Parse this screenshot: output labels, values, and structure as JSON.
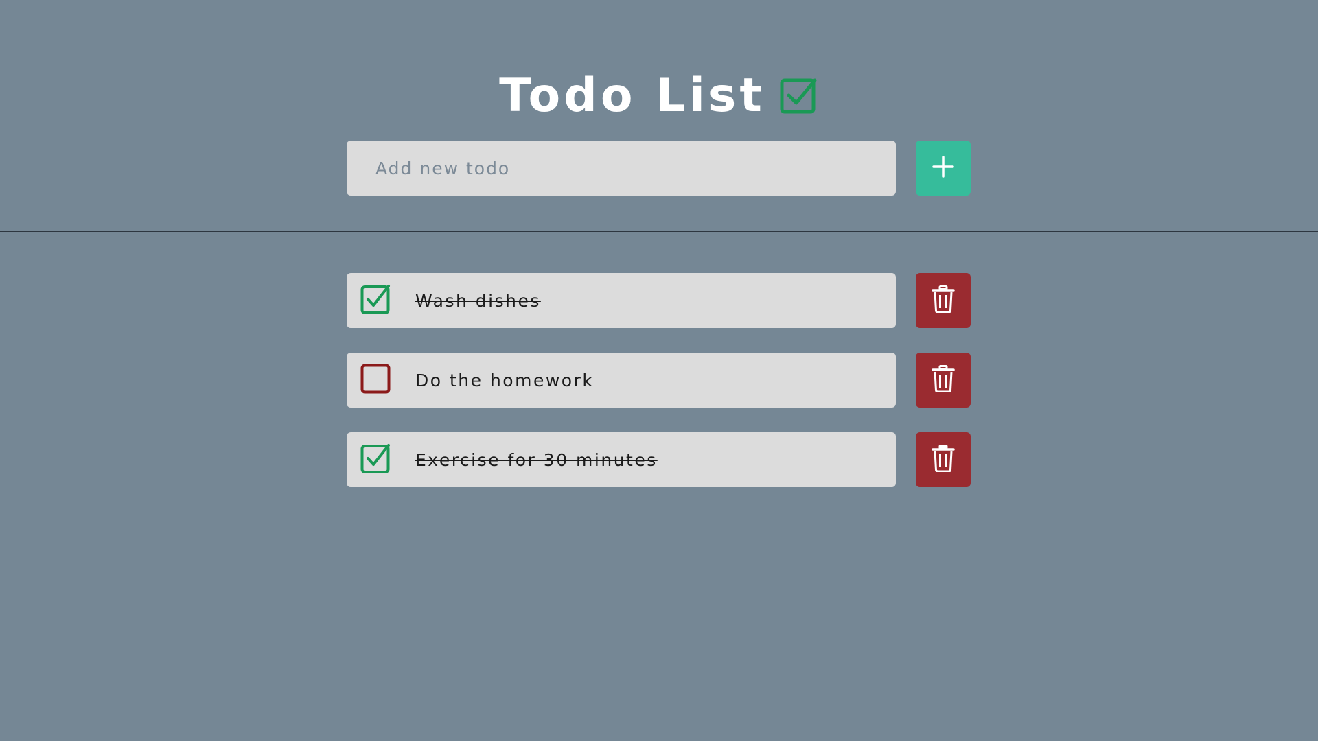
{
  "header": {
    "title": "Todo List",
    "title_icon": "checked-box-icon"
  },
  "new_todo": {
    "placeholder": "Add new todo",
    "value": "",
    "add_icon": "plus-icon"
  },
  "todos": [
    {
      "text": "Wash dishes",
      "done": true
    },
    {
      "text": "Do the homework",
      "done": false
    },
    {
      "text": "Exercise for 30 minutes",
      "done": true
    }
  ],
  "icons": {
    "checked": "checked-box-icon",
    "unchecked": "unchecked-box-icon",
    "delete": "trash-icon"
  },
  "colors": {
    "background": "#758795",
    "card": "#dcdcdc",
    "accent_add": "#36bc9b",
    "delete": "#9a2b30",
    "check_done": "#1a9955",
    "check_undone": "#8b1a1a"
  }
}
